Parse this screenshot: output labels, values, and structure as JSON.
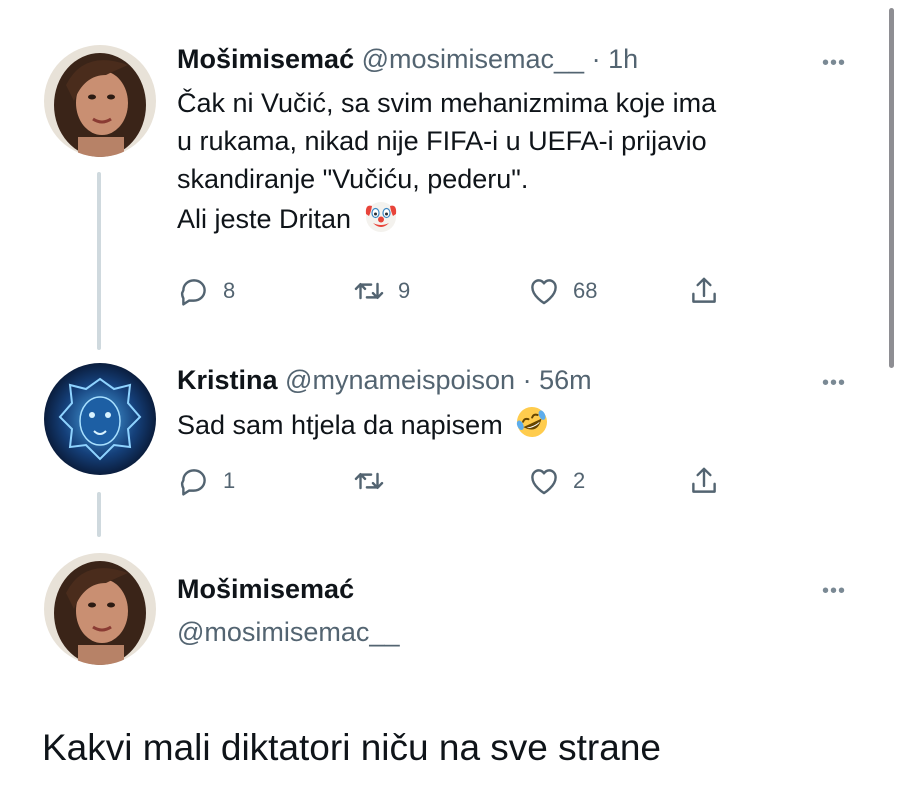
{
  "tweets": [
    {
      "name": "Mošimisemać",
      "handle": "@mosimisemac__",
      "separator": "·",
      "time": "1h",
      "more": "•••",
      "lines": [
        "Čak ni Vučić, sa svim mehanizmima koje ima",
        "u rukama, nikad nije FIFA-i u UEFA-i prijavio",
        "skandiranje \"Vučiću, pederu\".",
        "Ali jeste Dritan"
      ],
      "emoji": "clown-face",
      "replies": "8",
      "retweets": "9",
      "likes": "68"
    },
    {
      "name": "Kristina",
      "handle": "@mynameispoison",
      "separator": "·",
      "time": "56m",
      "more": "•••",
      "lines": [
        "Sad sam htjela da napisem"
      ],
      "emoji": "rolling-on-floor-laughing",
      "replies": "1",
      "retweets": "",
      "likes": "2"
    }
  ],
  "main_tweet": {
    "name": "Mošimisemać",
    "handle": "@mosimisemac__",
    "more": "•••",
    "text": "Kakvi mali diktatori niču na sve strane"
  },
  "colors": {
    "text": "#0f1419",
    "muted": "#536471",
    "thread_line": "#cfd9de"
  }
}
